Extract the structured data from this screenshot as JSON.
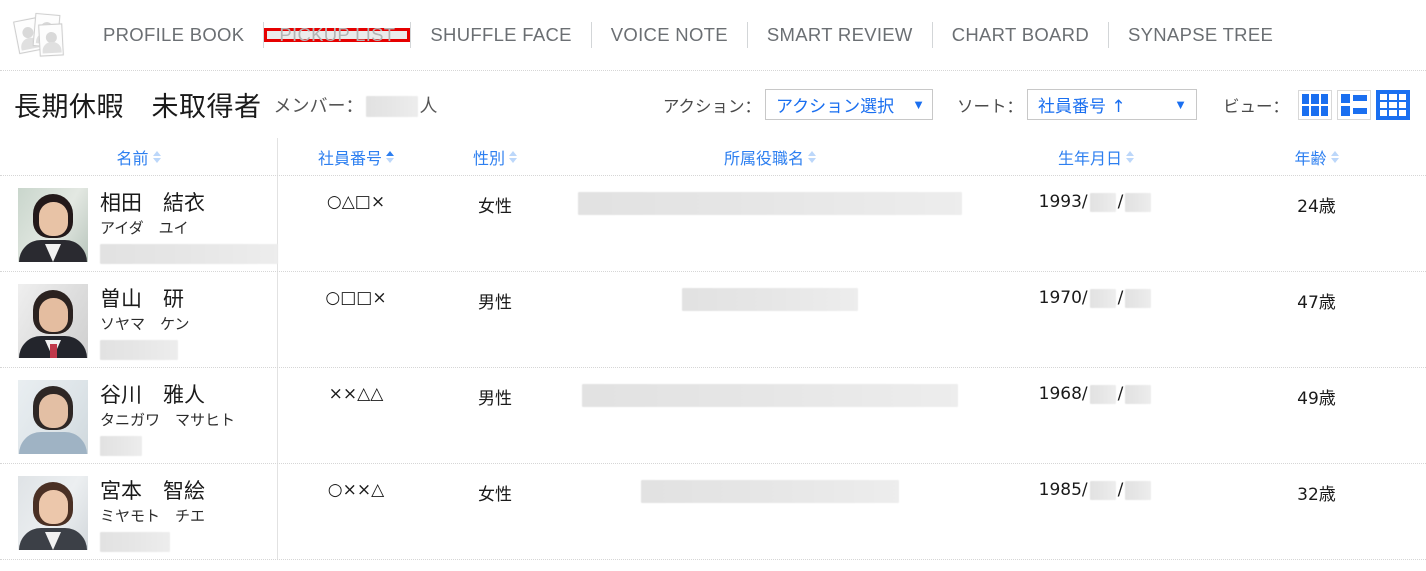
{
  "brand": {
    "logo_icon": "photo-cards-icon"
  },
  "nav": {
    "items": [
      {
        "label": "PROFILE BOOK",
        "active": false
      },
      {
        "label": "PICKUP LIST",
        "active": true
      },
      {
        "label": "SHUFFLE FACE",
        "active": false
      },
      {
        "label": "VOICE NOTE",
        "active": false
      },
      {
        "label": "SMART REVIEW",
        "active": false
      },
      {
        "label": "CHART BOARD",
        "active": false
      },
      {
        "label": "SYNAPSE TREE",
        "active": false
      }
    ],
    "annotation_color": "#e60000"
  },
  "header": {
    "title": "長期休暇　未取得者",
    "member_prefix": "メンバー：",
    "member_suffix": "人",
    "member_count": "[redacted]"
  },
  "toolbar": {
    "action_label": "アクション：",
    "action_value": "アクション選択",
    "sort_label": "ソート：",
    "sort_value": "社員番号 ↑",
    "view_label": "ビュー：",
    "caret_glyph": "▼",
    "accent_color": "#1a6ff0",
    "views": [
      {
        "name": "grid-view",
        "selected": false
      },
      {
        "name": "list-view",
        "selected": false
      },
      {
        "name": "table-view",
        "selected": true
      }
    ]
  },
  "table": {
    "columns": [
      {
        "key": "name",
        "label": "名前",
        "sort": "none"
      },
      {
        "key": "empno",
        "label": "社員番号",
        "sort": "asc"
      },
      {
        "key": "gender",
        "label": "性別",
        "sort": "none"
      },
      {
        "key": "dept",
        "label": "所属役職名",
        "sort": "none"
      },
      {
        "key": "birth",
        "label": "生年月日",
        "sort": "none"
      },
      {
        "key": "age",
        "label": "年齢",
        "sort": "none"
      }
    ],
    "rows": [
      {
        "name_kanji": "相田　結衣",
        "name_kana": "アイダ　ユイ",
        "empno": "○△□×",
        "gender": "女性",
        "dept": "[redacted]",
        "birth_year": "1993/",
        "birth_sep": "/",
        "age": "24歳"
      },
      {
        "name_kanji": "曽山　研",
        "name_kana": "ソヤマ　ケン",
        "empno": "○□□×",
        "gender": "男性",
        "dept": "[redacted]",
        "birth_year": "1970/",
        "birth_sep": "/",
        "age": "47歳"
      },
      {
        "name_kanji": "谷川　雅人",
        "name_kana": "タニガワ　マサヒト",
        "empno": "××△△",
        "gender": "男性",
        "dept": "[redacted]",
        "birth_year": "1968/",
        "birth_sep": "/",
        "age": "49歳"
      },
      {
        "name_kanji": "宮本　智絵",
        "name_kana": "ミヤモト　チエ",
        "empno": "○××△",
        "gender": "女性",
        "dept": "[redacted]",
        "birth_year": "1985/",
        "birth_sep": "/",
        "age": "32歳"
      }
    ]
  }
}
